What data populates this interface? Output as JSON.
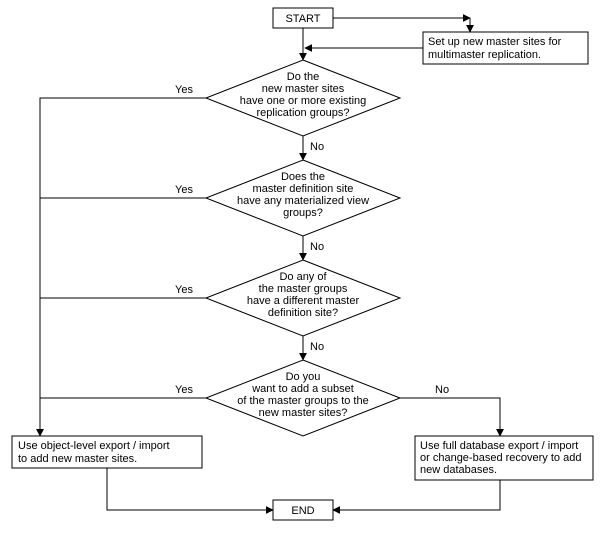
{
  "chart_data": {
    "type": "flowchart",
    "title": "",
    "nodes": [
      {
        "id": "start",
        "type": "terminator",
        "label": "START"
      },
      {
        "id": "setup",
        "type": "process",
        "label": "Set up new master sites for multimaster replication."
      },
      {
        "id": "d1",
        "type": "decision",
        "label": "Do the new master sites have one or more existing replication groups?"
      },
      {
        "id": "d2",
        "type": "decision",
        "label": "Does the master definition site have any materialized view groups?"
      },
      {
        "id": "d3",
        "type": "decision",
        "label": "Do any of the master groups have a different master definition site?"
      },
      {
        "id": "d4",
        "type": "decision",
        "label": "Do you want to add a subset of the master groups to the new master sites?"
      },
      {
        "id": "pL",
        "type": "process",
        "label": "Use object-level export / import to add new master sites."
      },
      {
        "id": "pR",
        "type": "process",
        "label": "Use full database export / import or change-based recovery to add new databases."
      },
      {
        "id": "end",
        "type": "terminator",
        "label": "END"
      }
    ],
    "edges": [
      {
        "from": "start",
        "to": "setup"
      },
      {
        "from": "setup",
        "to": "d1"
      },
      {
        "from": "start",
        "to": "d1"
      },
      {
        "from": "d1",
        "to": "pL",
        "label": "Yes"
      },
      {
        "from": "d1",
        "to": "d2",
        "label": "No"
      },
      {
        "from": "d2",
        "to": "pL",
        "label": "Yes"
      },
      {
        "from": "d2",
        "to": "d3",
        "label": "No"
      },
      {
        "from": "d3",
        "to": "pL",
        "label": "Yes"
      },
      {
        "from": "d3",
        "to": "d4",
        "label": "No"
      },
      {
        "from": "d4",
        "to": "pL",
        "label": "Yes"
      },
      {
        "from": "d4",
        "to": "pR",
        "label": "No"
      },
      {
        "from": "pL",
        "to": "end"
      },
      {
        "from": "pR",
        "to": "end"
      }
    ]
  },
  "labels": {
    "start": "START",
    "end": "END",
    "setup_l1": "Set up new master sites for",
    "setup_l2": "multimaster replication.",
    "d1_l1": "Do the",
    "d1_l2": "new master sites",
    "d1_l3": "have one or more existing",
    "d1_l4": "replication groups?",
    "d2_l1": "Does the",
    "d2_l2": "master definition site",
    "d2_l3": "have any materialized view",
    "d2_l4": "groups?",
    "d3_l1": "Do any of",
    "d3_l2": "the master groups",
    "d3_l3": "have a different master",
    "d3_l4": "definition site?",
    "d4_l1": "Do you",
    "d4_l2": "want to add a subset",
    "d4_l3": "of the master groups to the",
    "d4_l4": "new master sites?",
    "pL_l1": "Use object-level export / import",
    "pL_l2": "to add new master sites.",
    "pR_l1": "Use full database export / import",
    "pR_l2": "or change-based recovery to add",
    "pR_l3": "new databases.",
    "yes": "Yes",
    "no": "No"
  }
}
